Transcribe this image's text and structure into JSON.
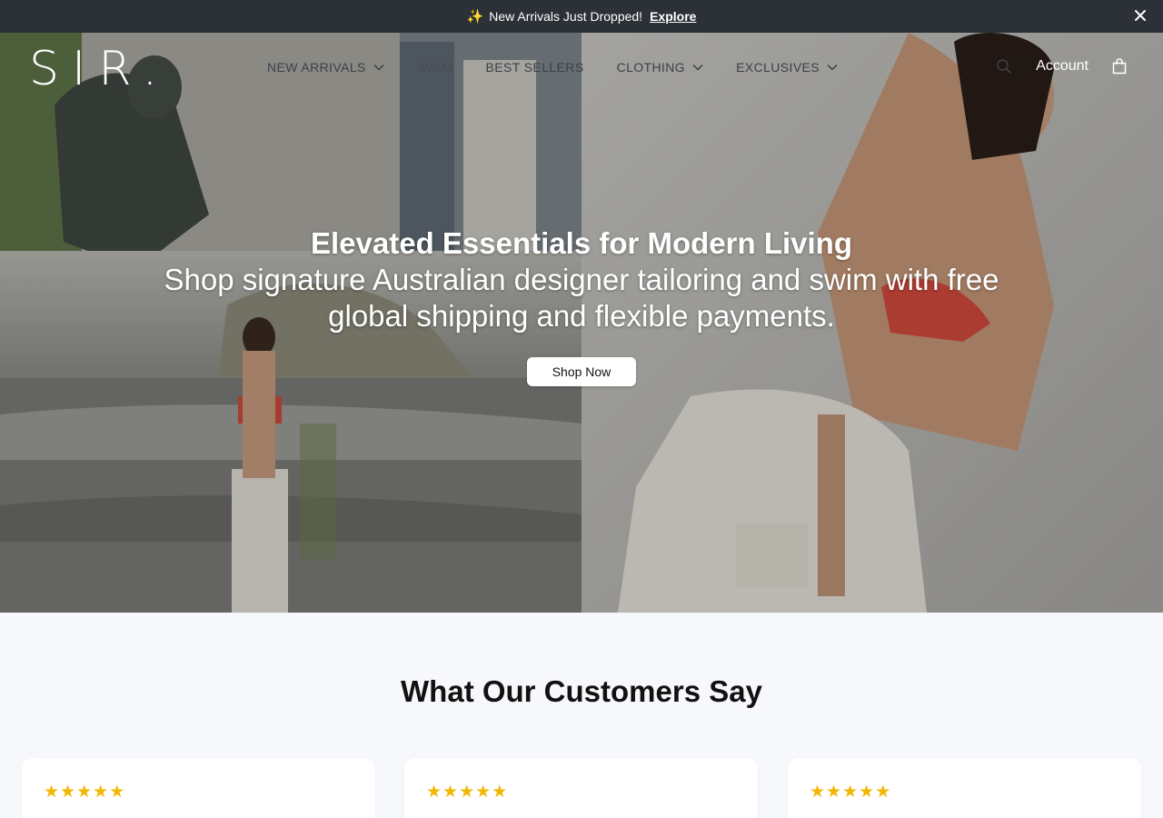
{
  "announcement": {
    "sparkle_icon": "sparkles-icon",
    "text": "New Arrivals Just Dropped!",
    "link": "Explore"
  },
  "header": {
    "logo": "SIR.",
    "nav": [
      {
        "label": "NEW ARRIVALS",
        "has_dropdown": true
      },
      {
        "label": "SWIM",
        "has_dropdown": false
      },
      {
        "label": "BEST SELLERS",
        "has_dropdown": false
      },
      {
        "label": "CLOTHING",
        "has_dropdown": true
      },
      {
        "label": "EXCLUSIVES",
        "has_dropdown": true
      }
    ],
    "account": "Account"
  },
  "hero": {
    "title": "Elevated Essentials for Modern Living",
    "subtitle": "Shop signature Australian designer tailoring and swim with free global shipping and flexible payments.",
    "cta": "Shop Now"
  },
  "reviews": {
    "title": "What Our Customers Say",
    "cards": [
      {
        "rating": 5
      },
      {
        "rating": 5
      },
      {
        "rating": 5
      }
    ]
  },
  "colors": {
    "announcement_bg": "#2b3136",
    "star": "#f2b705",
    "section_bg": "#f7f8fb"
  }
}
